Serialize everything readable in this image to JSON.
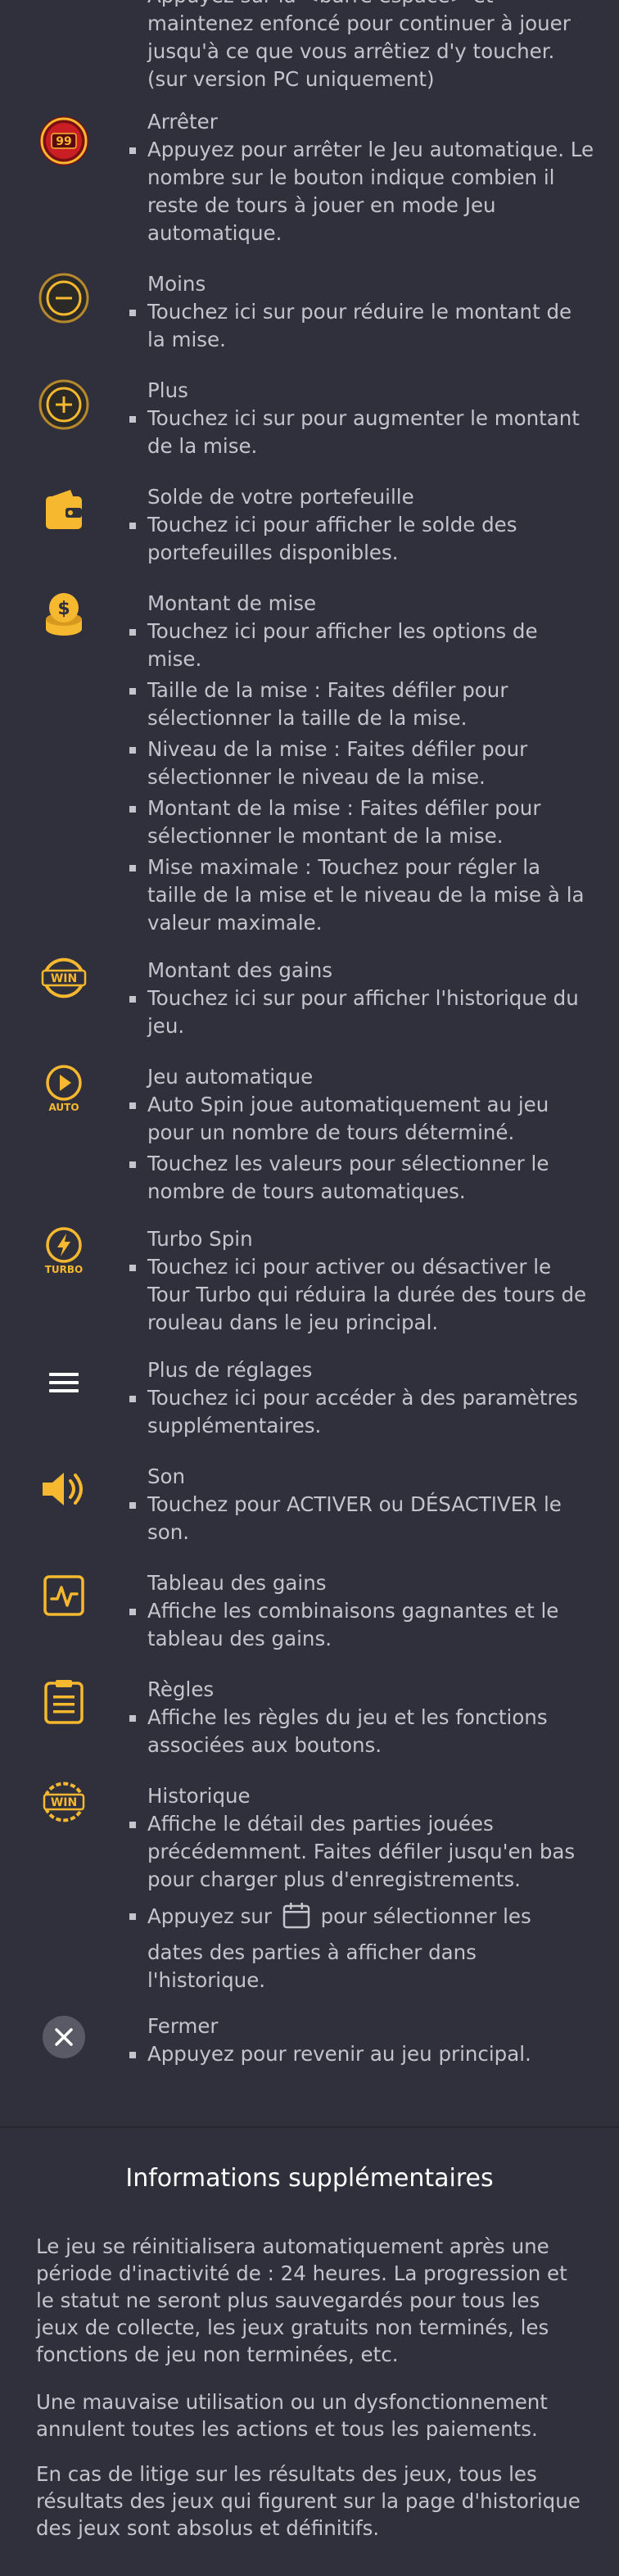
{
  "top_item": {
    "bullets": [
      "Appuyez sur la <barre espace> et maintenez enfoncé pour continuer à jouer jusqu'à ce que vous arrêtiez d'y toucher. (sur version PC uniquement)"
    ]
  },
  "items": [
    {
      "icon": "stop-counter-icon",
      "title": "Arrêter",
      "counter": "99",
      "bullets": [
        "Appuyez pour arrêter le Jeu automatique. Le nombre sur le bouton indique combien il reste de tours à jouer en mode Jeu automatique."
      ]
    },
    {
      "icon": "minus-icon",
      "title": "Moins",
      "bullets": [
        "Touchez ici sur pour réduire le montant de la mise."
      ]
    },
    {
      "icon": "plus-icon",
      "title": "Plus",
      "bullets": [
        "Touchez ici sur pour augmenter le montant de la mise."
      ]
    },
    {
      "icon": "wallet-icon",
      "title": "Solde de votre portefeuille",
      "bullets": [
        "Touchez ici pour afficher le solde des portefeuilles disponibles."
      ]
    },
    {
      "icon": "coins-icon",
      "title": "Montant de mise",
      "bullets": [
        "Touchez ici pour afficher les options de mise.",
        "Taille de la mise : Faites défiler pour sélectionner la taille de la mise.",
        "Niveau de la mise : Faites défiler pour sélectionner le niveau de la mise.",
        "Montant de la mise : Faites défiler pour sélectionner le montant de la mise.",
        "Mise maximale : Touchez pour régler la taille de la mise et le niveau de la mise à la valeur maximale."
      ]
    },
    {
      "icon": "win-icon",
      "title": "Montant des gains",
      "badge": "WIN",
      "bullets": [
        "Touchez ici sur pour afficher l'historique du jeu."
      ]
    },
    {
      "icon": "auto-play-icon",
      "title": "Jeu automatique",
      "badge": "AUTO",
      "bullets": [
        "Auto Spin joue automatiquement au jeu pour un nombre de tours déterminé.",
        "Touchez les valeurs pour sélectionner le nombre de tours automatiques."
      ]
    },
    {
      "icon": "turbo-icon",
      "title": "Turbo Spin",
      "badge": "TURBO",
      "bullets": [
        "Touchez ici pour activer ou désactiver le Tour Turbo qui réduira la durée des tours de rouleau dans le jeu principal."
      ]
    },
    {
      "icon": "menu-icon",
      "title": "Plus de réglages",
      "bullets": [
        "Touchez ici pour accéder à des paramètres supplémentaires."
      ]
    },
    {
      "icon": "sound-icon",
      "title": "Son",
      "bullets": [
        "Touchez pour ACTIVER ou DÉSACTIVER le son."
      ]
    },
    {
      "icon": "paytable-icon",
      "title": "Tableau des gains",
      "bullets": [
        "Affiche les combinaisons gagnantes et le tableau des gains."
      ]
    },
    {
      "icon": "rules-icon",
      "title": "Règles",
      "bullets": [
        "Affiche les règles du jeu et les fonctions associées aux boutons."
      ]
    },
    {
      "icon": "history-icon",
      "title": "Historique",
      "badge": "WIN",
      "bullets": [
        "Affiche le détail des parties jouées précédemment. Faites défiler jusqu'en bas pour charger plus d'enregistrements."
      ],
      "calendar_bullet": {
        "before": "Appuyez sur",
        "after": "pour sélectionner les",
        "rest": "dates des parties à afficher dans l'historique."
      }
    },
    {
      "icon": "close-icon",
      "title": "Fermer",
      "bullets": [
        "Appuyez pour revenir au jeu principal."
      ]
    }
  ],
  "info": {
    "title": "Informations supplémentaires",
    "paragraphs": [
      "Le jeu se réinitialisera automatiquement après une période d'inactivité de : 24 heures. La progression et le statut ne seront plus sauvegardés pour tous les jeux de collecte, les jeux gratuits non terminés, les fonctions de jeu non terminées, etc.",
      "Une mauvaise utilisation ou un dysfonctionnement annulent toutes les actions et tous les paiements.",
      "En cas de litige sur les résultats des jeux, tous les résultats des jeux qui figurent sur la page d'historique des jeux sont absolus et définitifs."
    ]
  },
  "colors": {
    "background": "#30303c",
    "text": "#c4c4cc",
    "accent": "#f5b82e",
    "title": "#ffffff"
  }
}
